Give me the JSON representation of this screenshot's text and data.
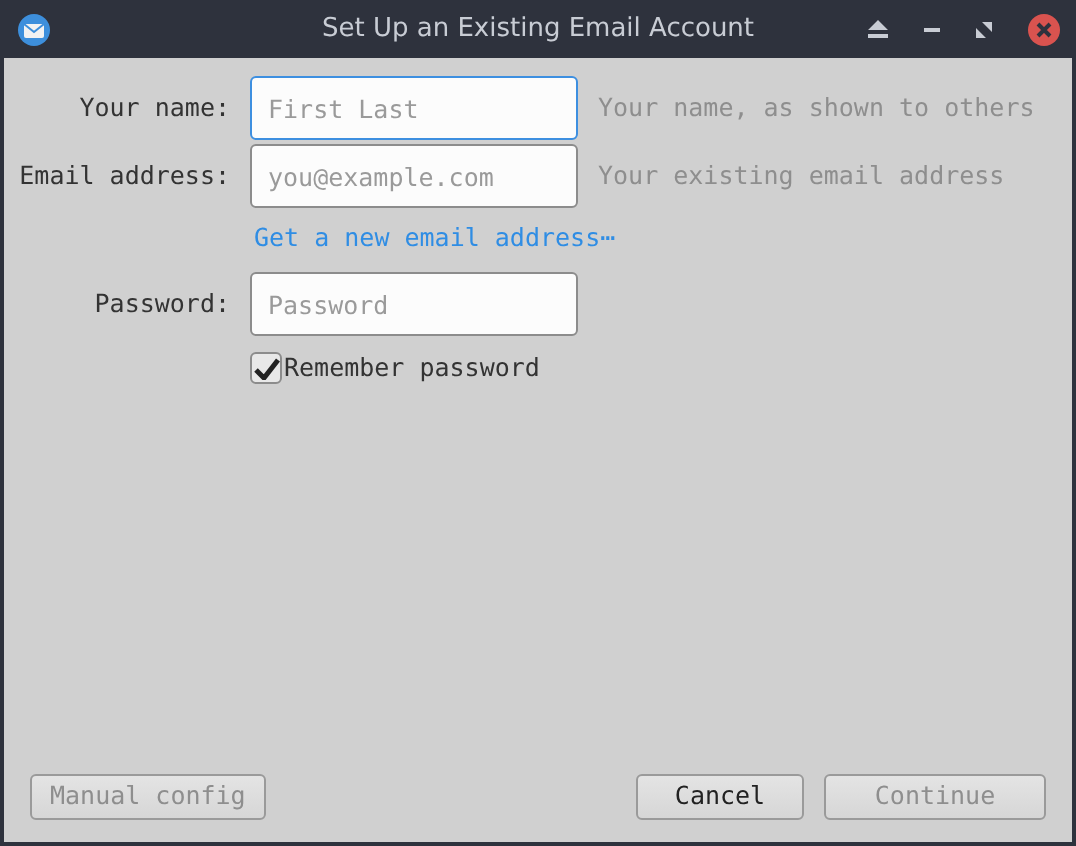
{
  "window": {
    "title": "Set Up an Existing Email Account"
  },
  "fields": [
    {
      "label": "Your name:",
      "placeholder": "First Last",
      "hint": "Your name, as shown to others",
      "focused": true
    },
    {
      "label": "Email address:",
      "placeholder": "you@example.com",
      "hint": "Your existing email address",
      "focused": false,
      "link": "Get a new email address⋯"
    },
    {
      "label": "Password:",
      "placeholder": "Password",
      "focused": false
    }
  ],
  "remember": {
    "label": "Remember password",
    "checked": true
  },
  "left_buttons": [
    {
      "label": "Manual config",
      "disabled": true
    }
  ],
  "right_buttons": [
    {
      "label": "Cancel",
      "disabled": false
    },
    {
      "label": "Continue",
      "disabled": true
    }
  ]
}
